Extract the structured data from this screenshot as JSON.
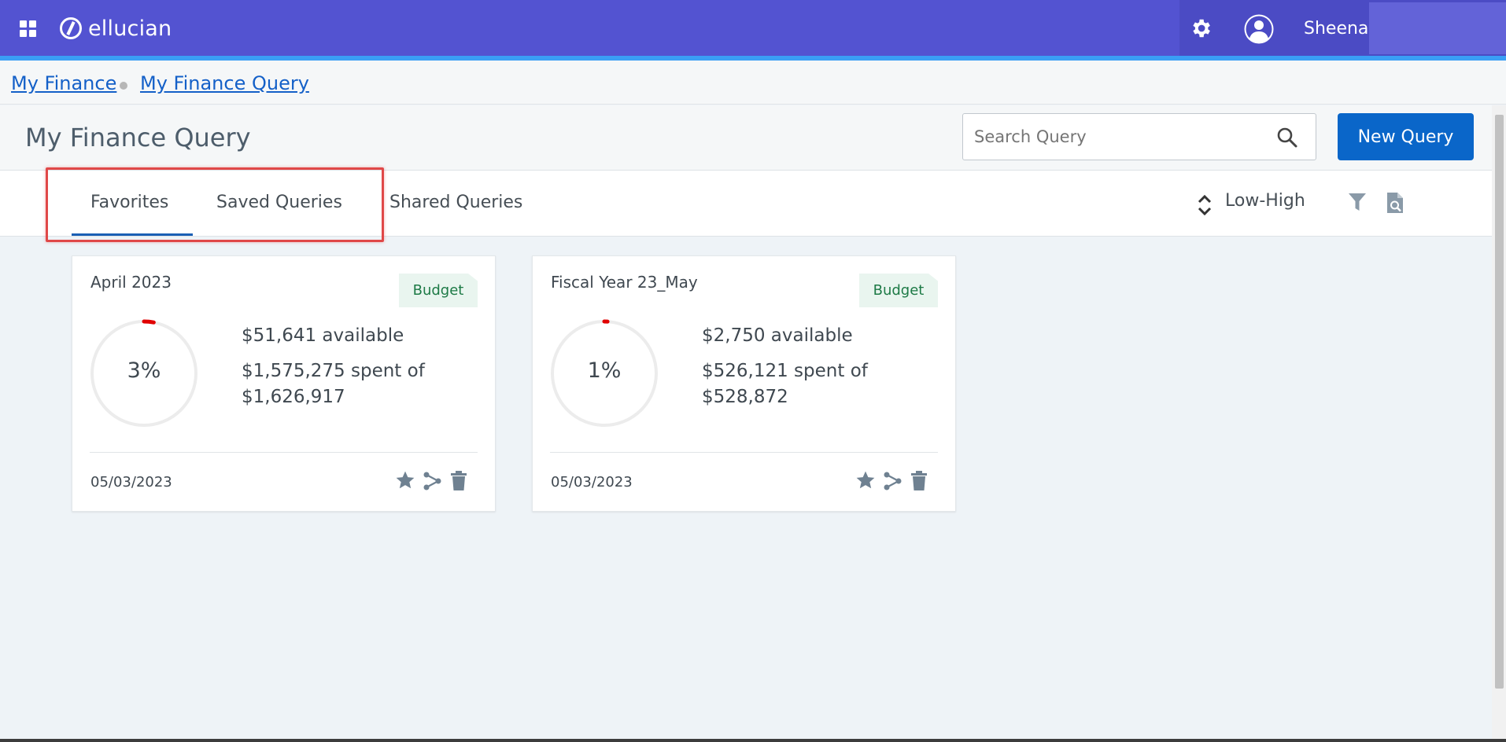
{
  "app": {
    "logo_text": "ellucian",
    "user_name": "Sheena"
  },
  "breadcrumb": {
    "items": [
      "My Finance",
      "My Finance Query"
    ]
  },
  "header": {
    "title": "My Finance Query",
    "search_placeholder": "Search Query",
    "new_query_label": "New Query"
  },
  "tabs": {
    "items": [
      "Favorites",
      "Saved Queries",
      "Shared Queries"
    ],
    "active": "Favorites"
  },
  "toolbar": {
    "sort_label": "Low-High"
  },
  "colors": {
    "topbar": "#5353d1",
    "accent_blue": "#0a66c9",
    "progress_red": "#e00000",
    "badge_green": "#1d7a46",
    "highlight_red": "#e04848"
  },
  "cards": [
    {
      "title": "April 2023",
      "badge": "Budget",
      "percent_label": "3%",
      "percent": 3,
      "available": "$51,641 available",
      "spent_line1": "$1,575,275 spent of",
      "spent_line2": "$1,626,917",
      "date": "05/03/2023"
    },
    {
      "title": "Fiscal Year 23_May",
      "badge": "Budget",
      "percent_label": "1%",
      "percent": 1,
      "available": "$2,750 available",
      "spent_line1": "$526,121 spent of",
      "spent_line2": "$528,872",
      "date": "05/03/2023"
    }
  ]
}
